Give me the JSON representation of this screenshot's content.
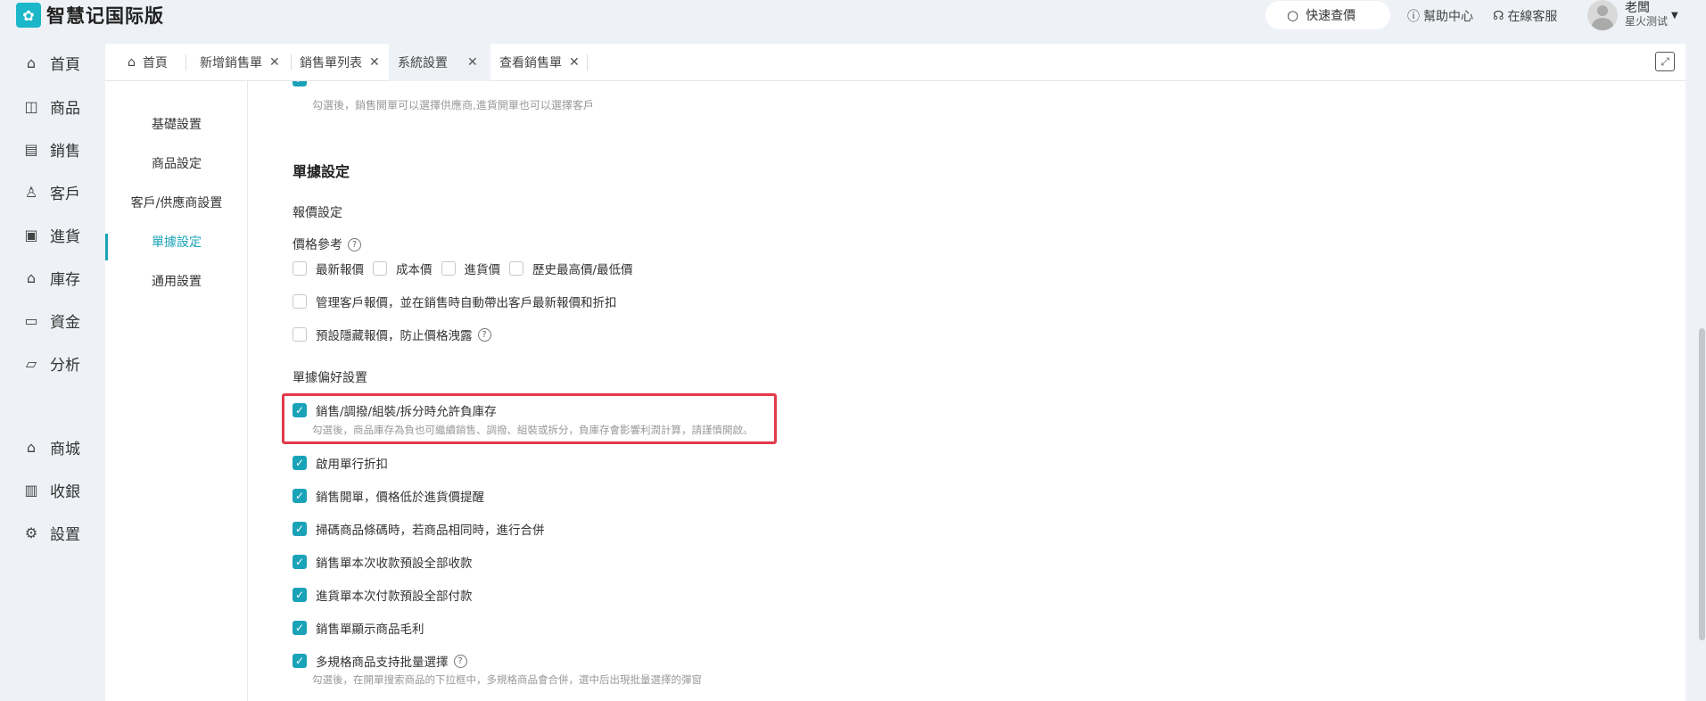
{
  "app": {
    "logo_text": "智慧记国际版"
  },
  "topbar": {
    "quick_price": "快速查價",
    "help": "幫助中心",
    "service": "在線客服",
    "user_name": "老闆",
    "user_sub": "星火测试"
  },
  "nav": {
    "items": [
      {
        "label": "首頁"
      },
      {
        "label": "商品"
      },
      {
        "label": "銷售"
      },
      {
        "label": "客戶"
      },
      {
        "label": "進貨"
      },
      {
        "label": "庫存"
      },
      {
        "label": "資金"
      },
      {
        "label": "分析"
      },
      {
        "label": "商城"
      },
      {
        "label": "收銀"
      },
      {
        "label": "設置"
      }
    ]
  },
  "tabs": [
    {
      "label": "首頁"
    },
    {
      "label": "新增銷售單"
    },
    {
      "label": "銷售單列表"
    },
    {
      "label": "系統設置"
    },
    {
      "label": "查看銷售單"
    }
  ],
  "subnav": [
    {
      "label": "基礎設置"
    },
    {
      "label": "商品設定"
    },
    {
      "label": "客戶/供應商設置"
    },
    {
      "label": "單據設定"
    },
    {
      "label": "通用設置"
    }
  ],
  "content": {
    "top_hint": "勾選後，銷售開單可以選擇供應商,進貨開單也可以選擇客戶",
    "section_title": "單據設定",
    "quote_group": "報價設定",
    "price_ref_label": "價格參考",
    "price_ref_options": [
      "最新報價",
      "成本價",
      "進貨價",
      "歷史最高價/最低價"
    ],
    "manage_quote": "管理客戶報價，並在銷售時自動帶出客戶最新報價和折扣",
    "hide_quote": "預設隱藏報價，防止價格洩露",
    "pref_group": "單據偏好設置",
    "negative_stock": "銷售/調撥/組裝/拆分時允許負庫存",
    "negative_stock_hint": "勾選後，商品庫存為負也可繼續銷售、調撥、組裝或拆分，負庫存會影響利潤計算，請謹慎開啟。",
    "line_discount": "啟用單行折扣",
    "below_cost": "銷售開單，價格低於進貨價提醒",
    "merge_scan": "掃碼商品條碼時，若商品相同時，進行合併",
    "full_receive": "銷售單本次收款預設全部收款",
    "full_pay": "進貨單本次付款預設全部付款",
    "show_margin": "銷售單顯示商品毛利",
    "batch_select": "多規格商品支持批量選擇",
    "batch_select_hint": "勾選後，在開單搜索商品的下拉框中，多規格商品會合併，選中后出現批量選擇的彈窗"
  },
  "colors": {
    "accent": "#1aa3b8",
    "highlight": "#e23a4a"
  }
}
